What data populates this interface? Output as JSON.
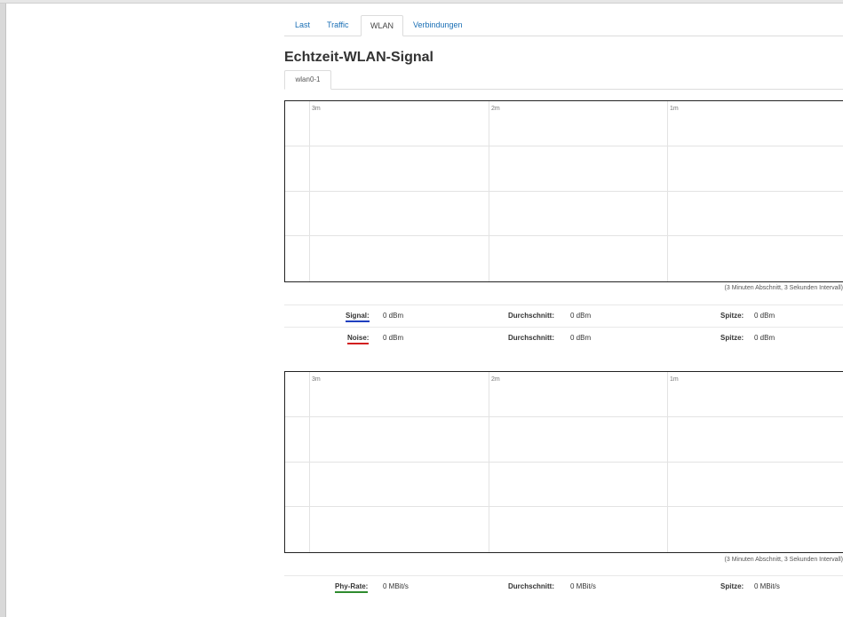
{
  "tabs": [
    {
      "label": "Last",
      "active": false
    },
    {
      "label": "Traffic",
      "active": false
    },
    {
      "label": "WLAN",
      "active": true
    },
    {
      "label": "Verbindungen",
      "active": false
    }
  ],
  "page_title": "Echtzeit-WLAN-Signal",
  "subtabs": [
    {
      "label": "wlan0-1",
      "active": true
    }
  ],
  "colors": {
    "signal": "#1f3fbf",
    "noise": "#d21f1f",
    "phy_rate": "#2e8b2e",
    "link": "#1a6fb5"
  },
  "signal_graph": {
    "time_ticks": [
      "3m",
      "2m",
      "1m"
    ],
    "note": "(3 Minuten Abschnitt, 3 Sekunden Intervall)",
    "rows": [
      {
        "label": "Signal:",
        "value": "0 dBm",
        "avg_label": "Durchschnitt:",
        "avg_value": "0 dBm",
        "peak_label": "Spitze:",
        "peak_value": "0 dBm"
      },
      {
        "label": "Noise:",
        "value": "0 dBm",
        "avg_label": "Durchschnitt:",
        "avg_value": "0 dBm",
        "peak_label": "Spitze:",
        "peak_value": "0 dBm"
      }
    ]
  },
  "rate_graph": {
    "time_ticks": [
      "3m",
      "2m",
      "1m"
    ],
    "note": "(3 Minuten Abschnitt, 3 Sekunden Intervall)",
    "rows": [
      {
        "label": "Phy-Rate:",
        "value": "0 MBit/s",
        "avg_label": "Durchschnitt:",
        "avg_value": "0 MBit/s",
        "peak_label": "Spitze:",
        "peak_value": "0 MBit/s"
      }
    ]
  }
}
